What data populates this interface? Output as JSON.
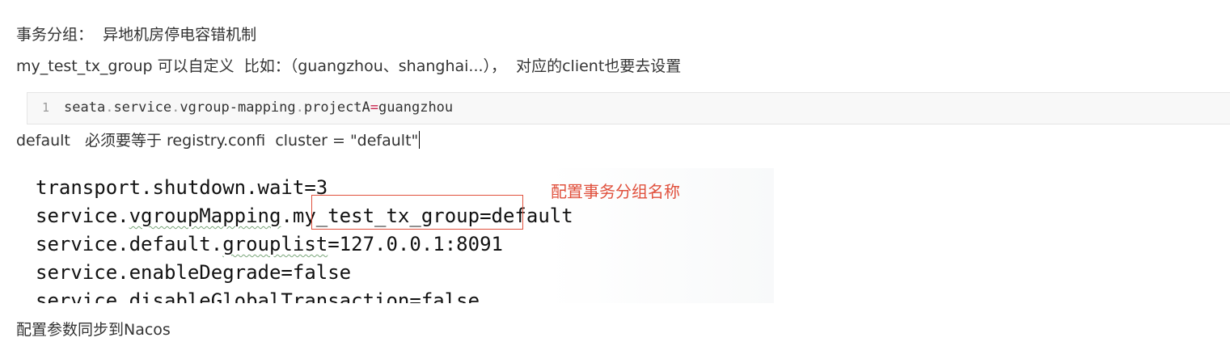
{
  "paragraphs": {
    "p1": "事务分组：  异地机房停电容错机制",
    "p2": "my_test_tx_group 可以自定义  比如：（guangzhou、shanghai...），  对应的client也要去设置",
    "p3": "default   必须要等于 registry.confi  cluster = \"default\"",
    "p4": "配置参数同步到Nacos"
  },
  "code_block": {
    "line_number": "1",
    "tokens": [
      "seata",
      ".",
      "service",
      ".",
      "vgroup-mapping",
      ".",
      "projectA",
      "=",
      "guangzhou"
    ]
  },
  "screenshot": {
    "lines": [
      "transport.shutdown.wait=3",
      "service.vgroupMapping.my_test_tx_group=default",
      "service.default.grouplist=127.0.0.1:8091",
      "service.enableDegrade=false",
      "service.disableGlobalTransaction=false"
    ],
    "line2_parts": [
      "service.",
      "vgroupMapping",
      ".my_test_tx_group=default"
    ],
    "line3_parts": [
      "service.default.",
      "grouplist",
      "=127.0.0.1:8091"
    ],
    "annotation": "配置事务分组名称",
    "annotation_color": "#e0503c"
  }
}
